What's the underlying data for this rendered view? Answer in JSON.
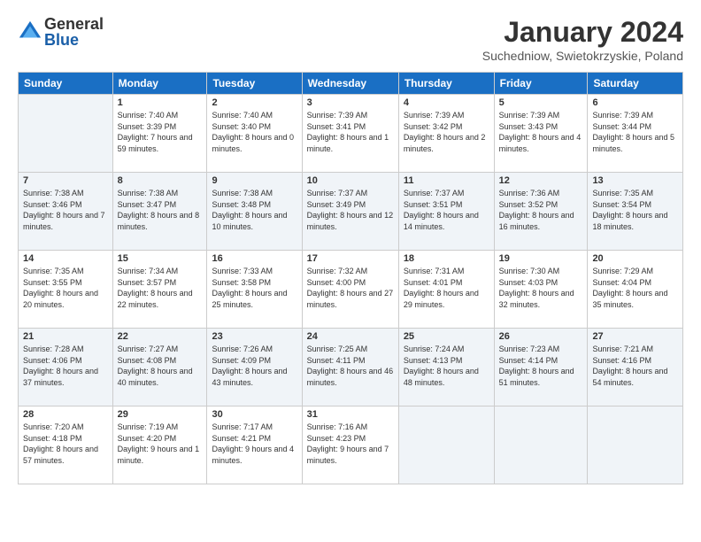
{
  "logo": {
    "general": "General",
    "blue": "Blue"
  },
  "title": "January 2024",
  "location": "Suchedniow, Swietokrzyskie, Poland",
  "days_header": [
    "Sunday",
    "Monday",
    "Tuesday",
    "Wednesday",
    "Thursday",
    "Friday",
    "Saturday"
  ],
  "weeks": [
    [
      {
        "num": "",
        "sunrise": "",
        "sunset": "",
        "daylight": ""
      },
      {
        "num": "1",
        "sunrise": "Sunrise: 7:40 AM",
        "sunset": "Sunset: 3:39 PM",
        "daylight": "Daylight: 7 hours and 59 minutes."
      },
      {
        "num": "2",
        "sunrise": "Sunrise: 7:40 AM",
        "sunset": "Sunset: 3:40 PM",
        "daylight": "Daylight: 8 hours and 0 minutes."
      },
      {
        "num": "3",
        "sunrise": "Sunrise: 7:39 AM",
        "sunset": "Sunset: 3:41 PM",
        "daylight": "Daylight: 8 hours and 1 minute."
      },
      {
        "num": "4",
        "sunrise": "Sunrise: 7:39 AM",
        "sunset": "Sunset: 3:42 PM",
        "daylight": "Daylight: 8 hours and 2 minutes."
      },
      {
        "num": "5",
        "sunrise": "Sunrise: 7:39 AM",
        "sunset": "Sunset: 3:43 PM",
        "daylight": "Daylight: 8 hours and 4 minutes."
      },
      {
        "num": "6",
        "sunrise": "Sunrise: 7:39 AM",
        "sunset": "Sunset: 3:44 PM",
        "daylight": "Daylight: 8 hours and 5 minutes."
      }
    ],
    [
      {
        "num": "7",
        "sunrise": "Sunrise: 7:38 AM",
        "sunset": "Sunset: 3:46 PM",
        "daylight": "Daylight: 8 hours and 7 minutes."
      },
      {
        "num": "8",
        "sunrise": "Sunrise: 7:38 AM",
        "sunset": "Sunset: 3:47 PM",
        "daylight": "Daylight: 8 hours and 8 minutes."
      },
      {
        "num": "9",
        "sunrise": "Sunrise: 7:38 AM",
        "sunset": "Sunset: 3:48 PM",
        "daylight": "Daylight: 8 hours and 10 minutes."
      },
      {
        "num": "10",
        "sunrise": "Sunrise: 7:37 AM",
        "sunset": "Sunset: 3:49 PM",
        "daylight": "Daylight: 8 hours and 12 minutes."
      },
      {
        "num": "11",
        "sunrise": "Sunrise: 7:37 AM",
        "sunset": "Sunset: 3:51 PM",
        "daylight": "Daylight: 8 hours and 14 minutes."
      },
      {
        "num": "12",
        "sunrise": "Sunrise: 7:36 AM",
        "sunset": "Sunset: 3:52 PM",
        "daylight": "Daylight: 8 hours and 16 minutes."
      },
      {
        "num": "13",
        "sunrise": "Sunrise: 7:35 AM",
        "sunset": "Sunset: 3:54 PM",
        "daylight": "Daylight: 8 hours and 18 minutes."
      }
    ],
    [
      {
        "num": "14",
        "sunrise": "Sunrise: 7:35 AM",
        "sunset": "Sunset: 3:55 PM",
        "daylight": "Daylight: 8 hours and 20 minutes."
      },
      {
        "num": "15",
        "sunrise": "Sunrise: 7:34 AM",
        "sunset": "Sunset: 3:57 PM",
        "daylight": "Daylight: 8 hours and 22 minutes."
      },
      {
        "num": "16",
        "sunrise": "Sunrise: 7:33 AM",
        "sunset": "Sunset: 3:58 PM",
        "daylight": "Daylight: 8 hours and 25 minutes."
      },
      {
        "num": "17",
        "sunrise": "Sunrise: 7:32 AM",
        "sunset": "Sunset: 4:00 PM",
        "daylight": "Daylight: 8 hours and 27 minutes."
      },
      {
        "num": "18",
        "sunrise": "Sunrise: 7:31 AM",
        "sunset": "Sunset: 4:01 PM",
        "daylight": "Daylight: 8 hours and 29 minutes."
      },
      {
        "num": "19",
        "sunrise": "Sunrise: 7:30 AM",
        "sunset": "Sunset: 4:03 PM",
        "daylight": "Daylight: 8 hours and 32 minutes."
      },
      {
        "num": "20",
        "sunrise": "Sunrise: 7:29 AM",
        "sunset": "Sunset: 4:04 PM",
        "daylight": "Daylight: 8 hours and 35 minutes."
      }
    ],
    [
      {
        "num": "21",
        "sunrise": "Sunrise: 7:28 AM",
        "sunset": "Sunset: 4:06 PM",
        "daylight": "Daylight: 8 hours and 37 minutes."
      },
      {
        "num": "22",
        "sunrise": "Sunrise: 7:27 AM",
        "sunset": "Sunset: 4:08 PM",
        "daylight": "Daylight: 8 hours and 40 minutes."
      },
      {
        "num": "23",
        "sunrise": "Sunrise: 7:26 AM",
        "sunset": "Sunset: 4:09 PM",
        "daylight": "Daylight: 8 hours and 43 minutes."
      },
      {
        "num": "24",
        "sunrise": "Sunrise: 7:25 AM",
        "sunset": "Sunset: 4:11 PM",
        "daylight": "Daylight: 8 hours and 46 minutes."
      },
      {
        "num": "25",
        "sunrise": "Sunrise: 7:24 AM",
        "sunset": "Sunset: 4:13 PM",
        "daylight": "Daylight: 8 hours and 48 minutes."
      },
      {
        "num": "26",
        "sunrise": "Sunrise: 7:23 AM",
        "sunset": "Sunset: 4:14 PM",
        "daylight": "Daylight: 8 hours and 51 minutes."
      },
      {
        "num": "27",
        "sunrise": "Sunrise: 7:21 AM",
        "sunset": "Sunset: 4:16 PM",
        "daylight": "Daylight: 8 hours and 54 minutes."
      }
    ],
    [
      {
        "num": "28",
        "sunrise": "Sunrise: 7:20 AM",
        "sunset": "Sunset: 4:18 PM",
        "daylight": "Daylight: 8 hours and 57 minutes."
      },
      {
        "num": "29",
        "sunrise": "Sunrise: 7:19 AM",
        "sunset": "Sunset: 4:20 PM",
        "daylight": "Daylight: 9 hours and 1 minute."
      },
      {
        "num": "30",
        "sunrise": "Sunrise: 7:17 AM",
        "sunset": "Sunset: 4:21 PM",
        "daylight": "Daylight: 9 hours and 4 minutes."
      },
      {
        "num": "31",
        "sunrise": "Sunrise: 7:16 AM",
        "sunset": "Sunset: 4:23 PM",
        "daylight": "Daylight: 9 hours and 7 minutes."
      },
      {
        "num": "",
        "sunrise": "",
        "sunset": "",
        "daylight": ""
      },
      {
        "num": "",
        "sunrise": "",
        "sunset": "",
        "daylight": ""
      },
      {
        "num": "",
        "sunrise": "",
        "sunset": "",
        "daylight": ""
      }
    ]
  ]
}
